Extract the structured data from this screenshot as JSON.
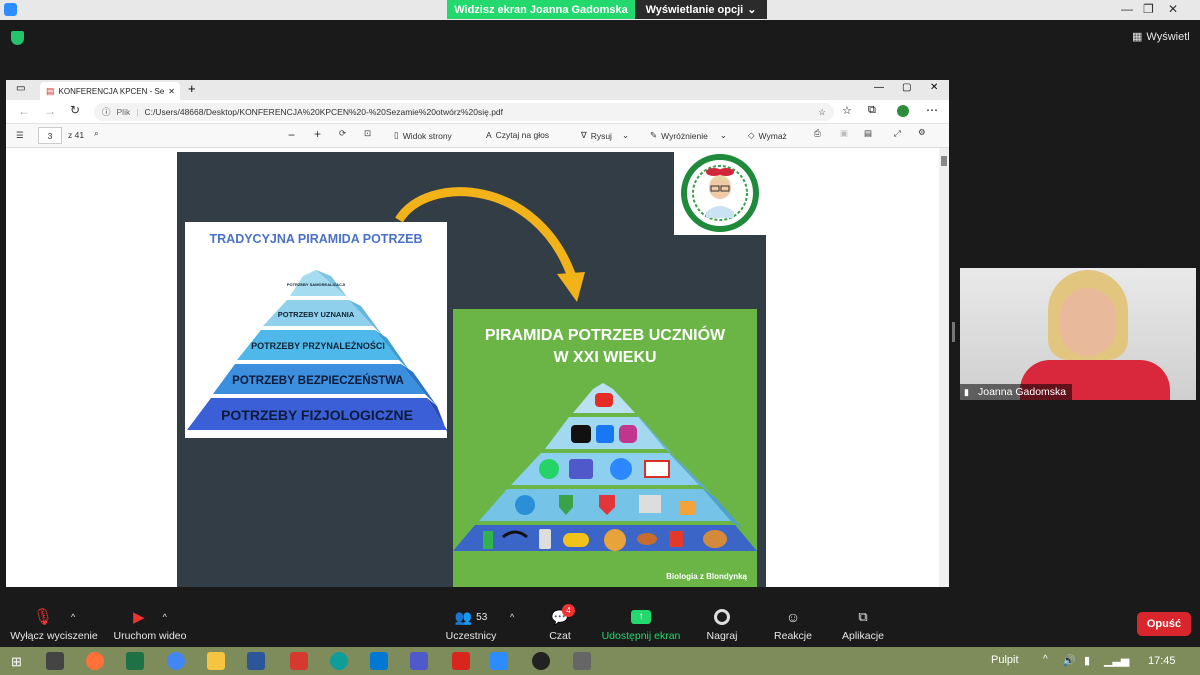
{
  "zoom": {
    "banner_text": "Widzisz ekran Joanna Gadomska",
    "view_options": "Wyświetlanie opcji",
    "view_button": "Wyświetl",
    "toolbar": {
      "mute": "Wyłącz wyciszenie",
      "video": "Uruchom wideo",
      "participants": "Uczestnicy",
      "participants_count": "53",
      "chat": "Czat",
      "chat_badge": "4",
      "share": "Udostępnij ekran",
      "record": "Nagraj",
      "reactions": "Reakcje",
      "apps": "Aplikacje",
      "leave": "Opuść"
    },
    "colors": {
      "share_green": "#23d96e",
      "leave_red": "#d9262c"
    }
  },
  "browser": {
    "tab_title": "KONFERENCJA KPCEN - Sezamie",
    "url_prefix": "Plik",
    "url": "C:/Users/48668/Desktop/KONFERENCJA%20KPCEN%20-%20Sezamie%20otwórz%20się.pdf"
  },
  "pdf_toolbar": {
    "page": "3",
    "page_total": "z 41",
    "view_page": "Widok strony",
    "read_aloud": "Czytaj na głos",
    "draw": "Rysuj",
    "highlight": "Wyróżnienie",
    "erase": "Wymaż"
  },
  "slide": {
    "left_title": "TRADYCYJNA PIRAMIDA POTRZEB",
    "levels": [
      "POTRZEBY SAMOREALIZACJI",
      "POTRZEBY UZNANIA",
      "POTRZEBY PRZYNALEŻNOŚCI",
      "POTRZEBY BEZPIECZEŃSTWA",
      "POTRZEBY FIZJOLOGICZNE"
    ],
    "right_title_1": "PIRAMIDA POTRZEB UCZNIÓW",
    "right_title_2": "W XXI WIEKU",
    "credit": "Biologia z Blondynką"
  },
  "video": {
    "participant_name": "Joanna Gadomska"
  },
  "taskbar": {
    "desktop": "Pulpit",
    "clock": "17:45"
  }
}
